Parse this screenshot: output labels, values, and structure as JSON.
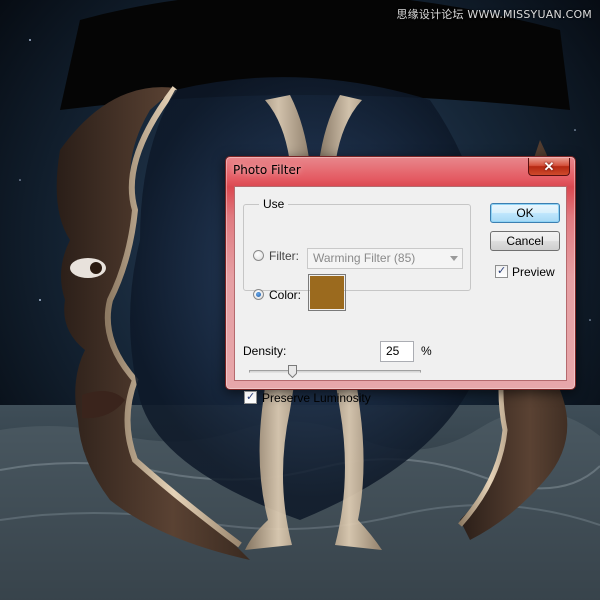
{
  "watermark": "思缘设计论坛 WWW.MISSYUAN.COM",
  "dialog": {
    "title": "Photo Filter",
    "close_glyph": "✕",
    "use_group_label": "Use",
    "filter_label": "Filter:",
    "filter_selected": "Warming Filter (85)",
    "color_label": "Color:",
    "color_swatch": "#9b6a1e",
    "use_mode": "color",
    "density_label": "Density:",
    "density_value": "25",
    "density_unit": "%",
    "density_fraction": 0.25,
    "preserve_luminosity_label": "Preserve Luminosity",
    "preserve_luminosity_checked": true,
    "ok_label": "OK",
    "cancel_label": "Cancel",
    "preview_label": "Preview",
    "preview_checked": true
  },
  "colors": {
    "titlebar_accent": "#e0474f",
    "window_bg": "#f0f0f0",
    "swatch": "#9b6a1e"
  }
}
